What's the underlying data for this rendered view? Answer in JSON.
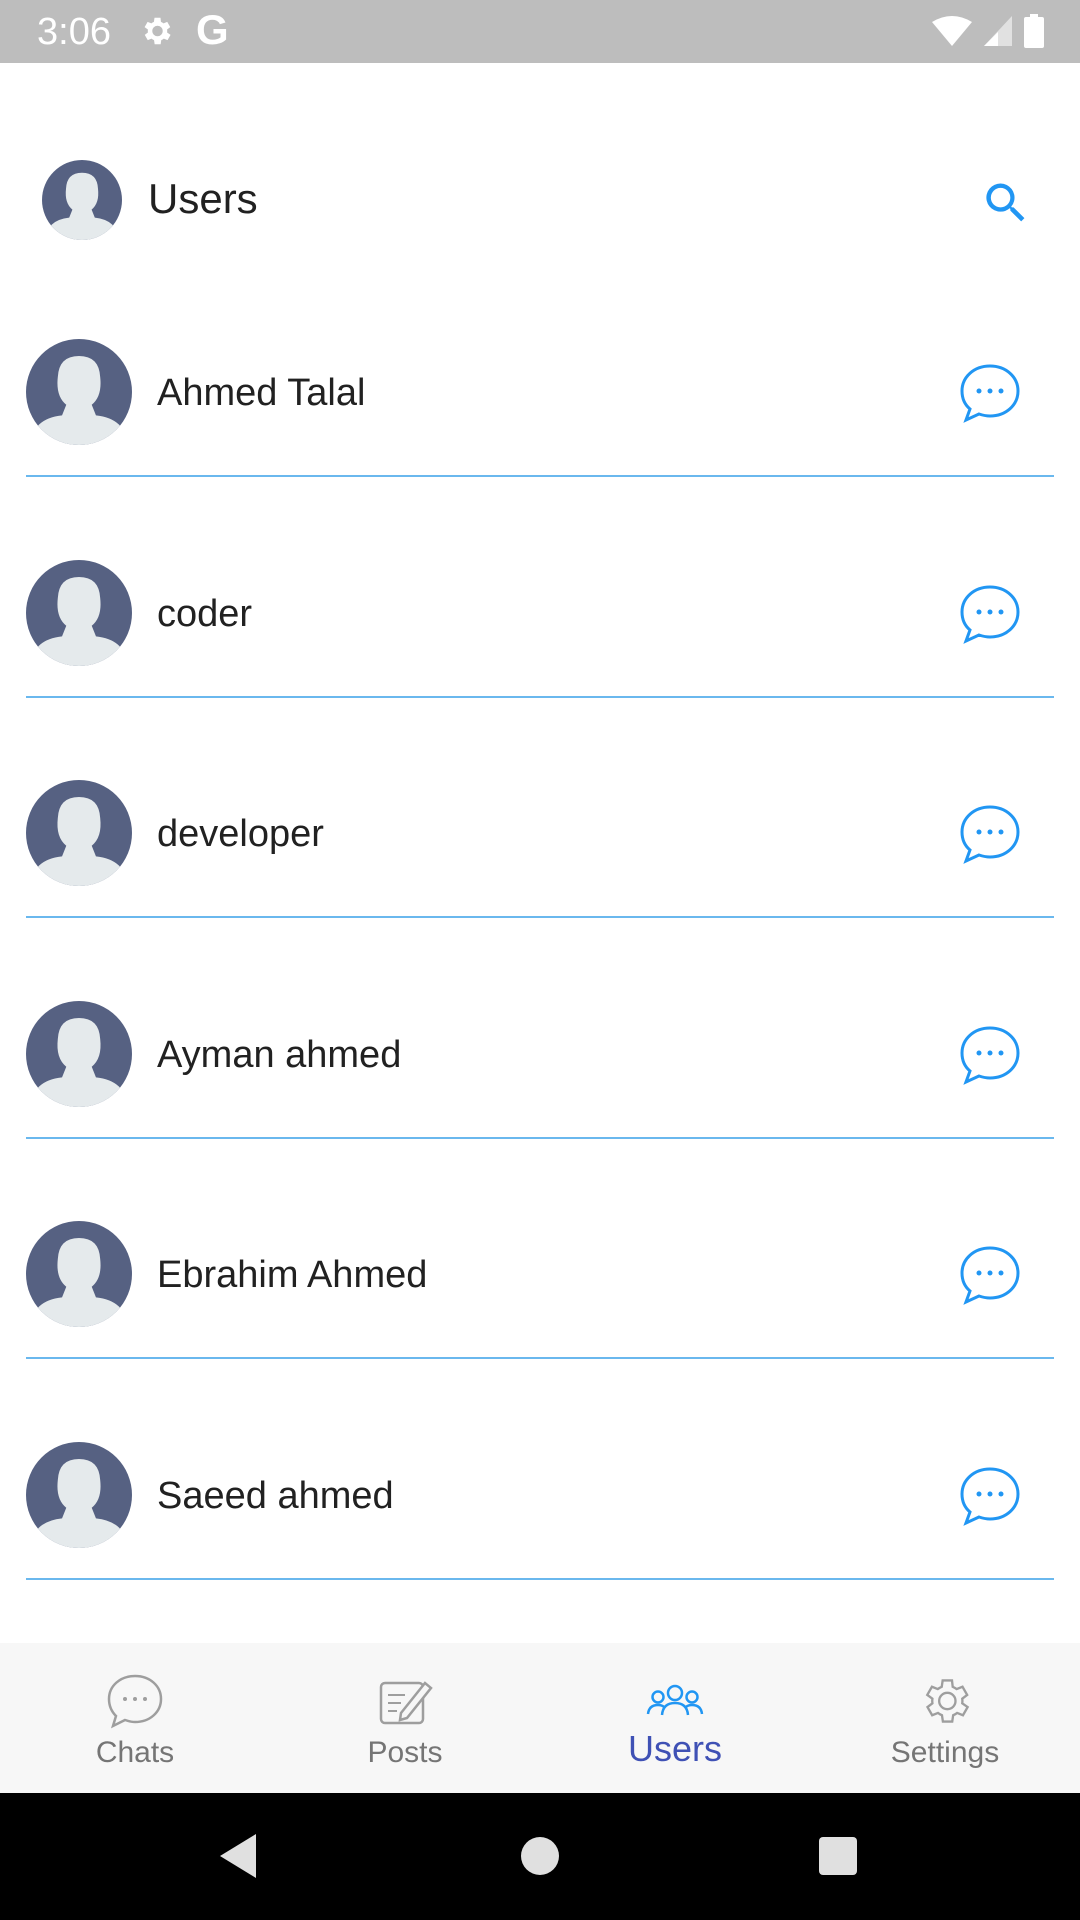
{
  "status_bar": {
    "time": "3:06",
    "g_label": "G"
  },
  "header": {
    "title": "Users"
  },
  "users": [
    {
      "name": "Ahmed Talal"
    },
    {
      "name": "coder"
    },
    {
      "name": "developer"
    },
    {
      "name": "Ayman ahmed"
    },
    {
      "name": "Ebrahim Ahmed"
    },
    {
      "name": "Saeed ahmed"
    }
  ],
  "bottom_nav": {
    "items": [
      {
        "label": "Chats",
        "icon": "chat-bubble-icon"
      },
      {
        "label": "Posts",
        "icon": "edit-note-icon"
      },
      {
        "label": "Users",
        "icon": "users-group-icon",
        "active": true
      },
      {
        "label": "Settings",
        "icon": "gear-icon"
      }
    ]
  },
  "colors": {
    "accent": "#2196f3",
    "active_nav": "#3f51b5",
    "divider": "#6ab8ee",
    "status_bar": "#bdbdbd",
    "avatar_bg": "#566182"
  }
}
